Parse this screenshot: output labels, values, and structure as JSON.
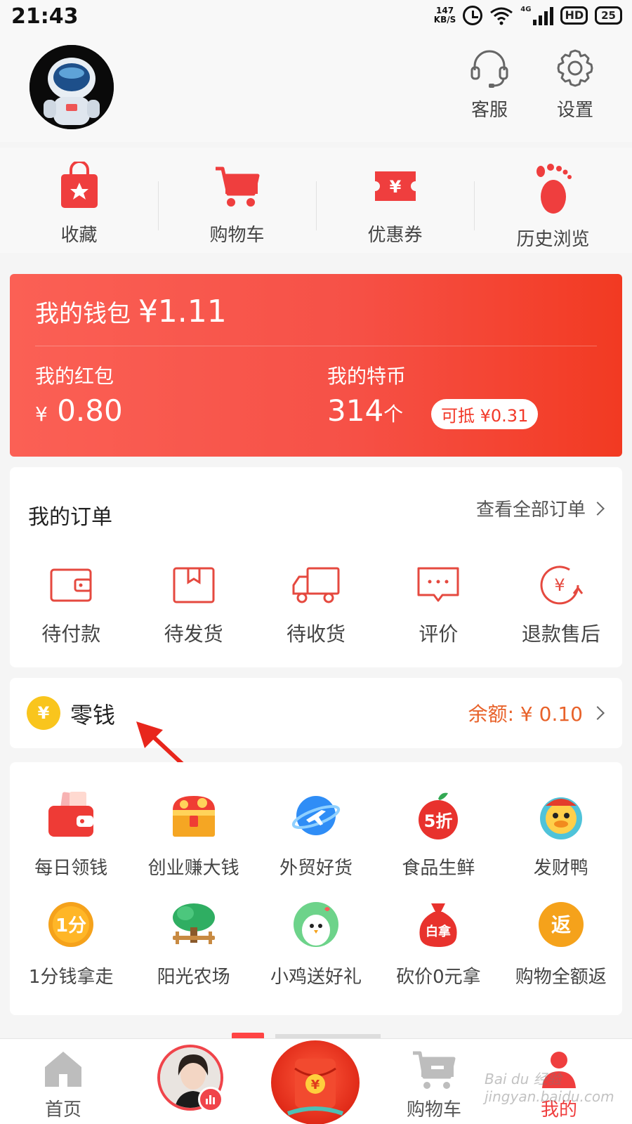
{
  "status_bar": {
    "time": "21:43",
    "net_speed_value": "147",
    "net_speed_unit": "KB/S",
    "network": "4G",
    "hd": "HD",
    "battery": "25"
  },
  "header": {
    "service_label": "客服",
    "settings_label": "设置"
  },
  "quick_links": [
    {
      "label": "收藏",
      "icon": "favorites-bag-icon"
    },
    {
      "label": "购物车",
      "icon": "cart-icon"
    },
    {
      "label": "优惠券",
      "icon": "coupon-icon"
    },
    {
      "label": "历史浏览",
      "icon": "footprint-icon"
    }
  ],
  "wallet": {
    "title": "我的钱包",
    "amount": "¥1.11",
    "redpacket_label": "我的红包",
    "redpacket_currency": "¥",
    "redpacket_value": "0.80",
    "coin_label": "我的特币",
    "coin_count": "314",
    "coin_unit": "个",
    "coin_offset": "可抵 ¥0.31"
  },
  "orders": {
    "title": "我的订单",
    "view_all": "查看全部订单",
    "items": [
      {
        "label": "待付款",
        "icon": "wallet-icon"
      },
      {
        "label": "待发货",
        "icon": "box-icon"
      },
      {
        "label": "待收货",
        "icon": "truck-icon"
      },
      {
        "label": "评价",
        "icon": "comment-icon"
      },
      {
        "label": "退款售后",
        "icon": "refund-icon"
      }
    ]
  },
  "change": {
    "coin_symbol": "¥",
    "title": "零钱",
    "balance": "余额: ¥ 0.10"
  },
  "services": [
    {
      "label": "每日领钱",
      "icon": "red-wallet-icon"
    },
    {
      "label": "创业赚大钱",
      "icon": "treasure-chest-icon"
    },
    {
      "label": "外贸好货",
      "icon": "globe-plane-icon"
    },
    {
      "label": "食品生鲜",
      "icon": "apple-discount-icon",
      "badge": "5折"
    },
    {
      "label": "发财鸭",
      "icon": "duck-icon"
    },
    {
      "label": "1分钱拿走",
      "icon": "one-cent-icon",
      "badge": "1分"
    },
    {
      "label": "阳光农场",
      "icon": "tree-icon"
    },
    {
      "label": "小鸡送好礼",
      "icon": "chick-icon"
    },
    {
      "label": "砍价0元拿",
      "icon": "money-bag-icon",
      "badge": "白拿"
    },
    {
      "label": "购物全额返",
      "icon": "rebate-icon",
      "badge": "返"
    }
  ],
  "tabbar": {
    "home": "首页",
    "cart": "购物车",
    "mine": "我的",
    "redpack_symbol": "¥"
  },
  "watermark": "Bai du 经验 jingyan.baidu.com",
  "colors": {
    "accent_red": "#f23a2a",
    "wallet_gradient_start": "#fb6055",
    "wallet_gradient_end": "#f23a22",
    "balance_orange": "#e8622a",
    "coin_yellow": "#f9c51d"
  }
}
